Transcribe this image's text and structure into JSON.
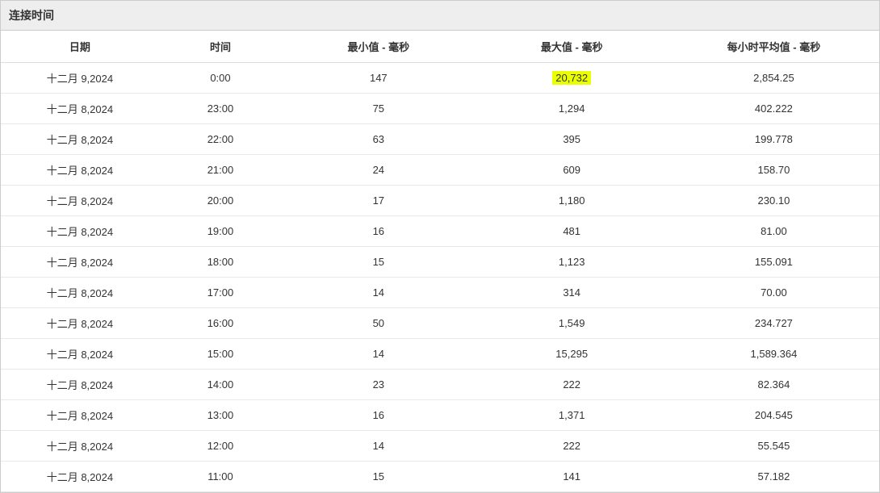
{
  "panel": {
    "title": "连接时间"
  },
  "table": {
    "headers": {
      "date": "日期",
      "time": "时间",
      "min": "最小值 - 毫秒",
      "max": "最大值 - 毫秒",
      "avg": "每小时平均值 - 毫秒"
    },
    "rows": [
      {
        "date": "十二月 9,2024",
        "time": "0:00",
        "min": "147",
        "max": "20,732",
        "avg": "2,854.25",
        "max_highlight": true
      },
      {
        "date": "十二月 8,2024",
        "time": "23:00",
        "min": "75",
        "max": "1,294",
        "avg": "402.222"
      },
      {
        "date": "十二月 8,2024",
        "time": "22:00",
        "min": "63",
        "max": "395",
        "avg": "199.778"
      },
      {
        "date": "十二月 8,2024",
        "time": "21:00",
        "min": "24",
        "max": "609",
        "avg": "158.70"
      },
      {
        "date": "十二月 8,2024",
        "time": "20:00",
        "min": "17",
        "max": "1,180",
        "avg": "230.10"
      },
      {
        "date": "十二月 8,2024",
        "time": "19:00",
        "min": "16",
        "max": "481",
        "avg": "81.00"
      },
      {
        "date": "十二月 8,2024",
        "time": "18:00",
        "min": "15",
        "max": "1,123",
        "avg": "155.091"
      },
      {
        "date": "十二月 8,2024",
        "time": "17:00",
        "min": "14",
        "max": "314",
        "avg": "70.00"
      },
      {
        "date": "十二月 8,2024",
        "time": "16:00",
        "min": "50",
        "max": "1,549",
        "avg": "234.727"
      },
      {
        "date": "十二月 8,2024",
        "time": "15:00",
        "min": "14",
        "max": "15,295",
        "avg": "1,589.364"
      },
      {
        "date": "十二月 8,2024",
        "time": "14:00",
        "min": "23",
        "max": "222",
        "avg": "82.364"
      },
      {
        "date": "十二月 8,2024",
        "time": "13:00",
        "min": "16",
        "max": "1,371",
        "avg": "204.545"
      },
      {
        "date": "十二月 8,2024",
        "time": "12:00",
        "min": "14",
        "max": "222",
        "avg": "55.545"
      },
      {
        "date": "十二月 8,2024",
        "time": "11:00",
        "min": "15",
        "max": "141",
        "avg": "57.182"
      }
    ]
  }
}
